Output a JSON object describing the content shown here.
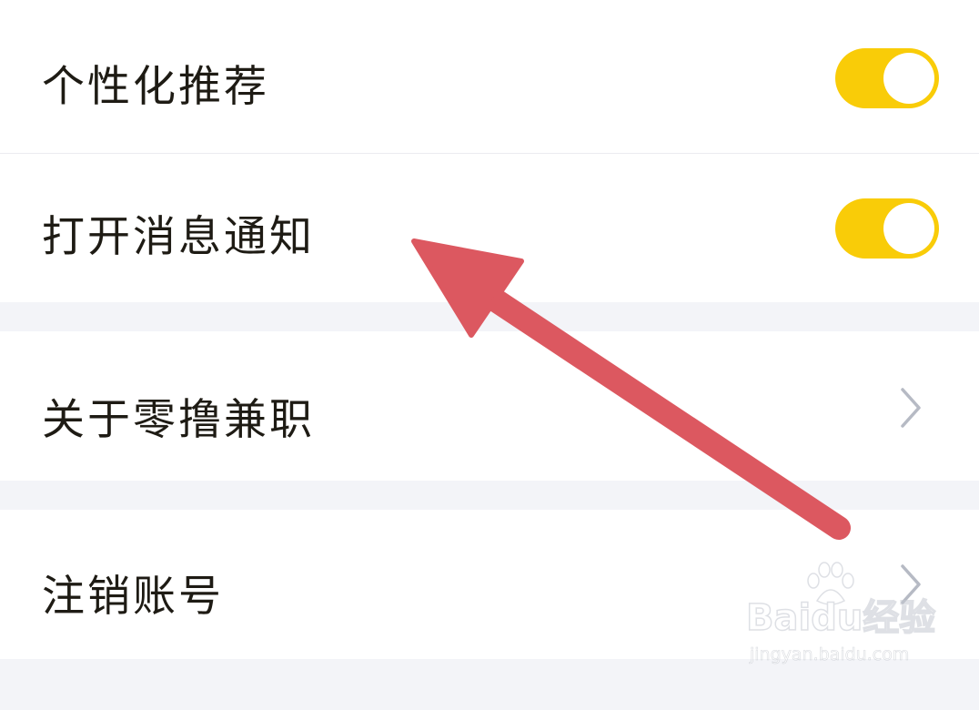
{
  "settings": {
    "personalized_recommend": {
      "label": "个性化推荐",
      "toggle_on": true
    },
    "message_notification": {
      "label": "打开消息通知",
      "toggle_on": true
    },
    "about": {
      "label": "关于零撸兼职"
    },
    "delete_account": {
      "label": "注销账号"
    }
  },
  "watermark": {
    "brand": "Baidu经验",
    "url": "jingyan.baidu.com"
  },
  "colors": {
    "toggle_on": "#f9cc08",
    "annotation_arrow": "#dc5860",
    "background": "#f3f4f8",
    "chevron": "#b6bac4"
  },
  "icons": {
    "row_chevron": "chevron-right-icon",
    "annotation": "red-arrow-icon"
  }
}
